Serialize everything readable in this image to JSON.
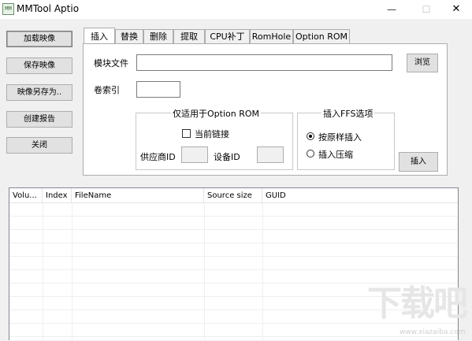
{
  "window": {
    "title": "MMTool Aptio",
    "app_icon_glyph": "MM",
    "minimize_glyph": "—",
    "maximize_glyph": "☐",
    "close_glyph": "✕"
  },
  "left_buttons": [
    {
      "id": "load-image",
      "label": "加载映像"
    },
    {
      "id": "save-image",
      "label": "保存映像"
    },
    {
      "id": "save-image-as",
      "label": "映像另存为.."
    },
    {
      "id": "create-report",
      "label": "创建报告"
    },
    {
      "id": "close",
      "label": "关闭"
    }
  ],
  "tabs": [
    {
      "label": "插入",
      "active": true
    },
    {
      "label": "替换"
    },
    {
      "label": "删除"
    },
    {
      "label": "提取"
    },
    {
      "label": "CPU补丁"
    },
    {
      "label": "RomHole"
    },
    {
      "label": "Option ROM"
    }
  ],
  "insert_panel": {
    "module_file_label": "模块文件",
    "module_file_value": "",
    "browse_label": "浏览",
    "volume_index_label": "卷索引",
    "volume_index_value": "",
    "option_rom_group": {
      "title": "仅适用于Option ROM",
      "current_link_label": "当前链接",
      "current_link_checked": false,
      "vendor_id_label": "供应商ID",
      "vendor_id_value": "",
      "device_id_label": "设备ID",
      "device_id_value": ""
    },
    "ffs_group": {
      "title": "插入FFS选项",
      "options": [
        "按原样插入",
        "插入压缩"
      ],
      "selected": "按原样插入"
    },
    "insert_button_label": "插入"
  },
  "table": {
    "columns": [
      "Volu...",
      "Index",
      "FileName",
      "Source size",
      "GUID"
    ],
    "rows": []
  },
  "watermark": {
    "main": "下载吧",
    "sub": "www.xiazaiba.com"
  }
}
